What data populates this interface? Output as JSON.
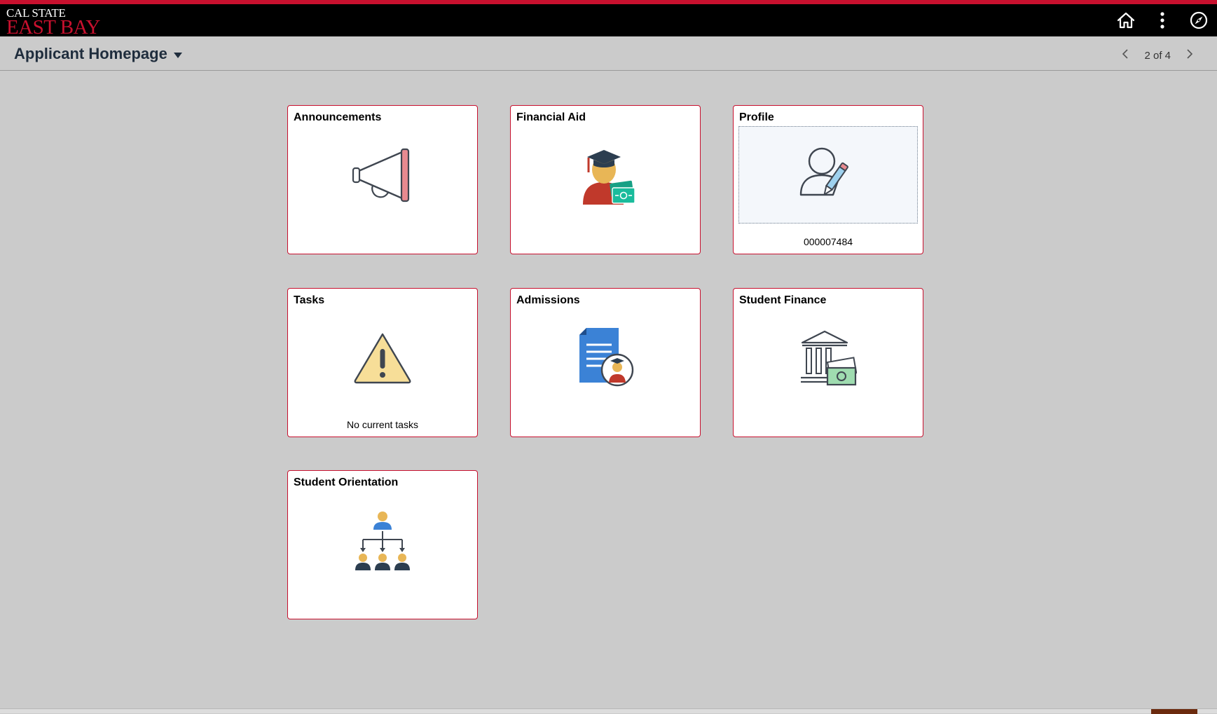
{
  "header": {
    "logo_line1": "CAL STATE",
    "logo_line2": "EAST BAY",
    "brand_red": "#c8102e",
    "icons": [
      "home-icon",
      "actions-menu-icon",
      "navbar-compass-icon"
    ]
  },
  "page": {
    "title": "Applicant Homepage",
    "pager_text": "2 of 4"
  },
  "tiles": [
    {
      "title": "Announcements",
      "icon": "megaphone-icon",
      "subtext": ""
    },
    {
      "title": "Financial Aid",
      "icon": "graduate-money-icon",
      "subtext": ""
    },
    {
      "title": "Profile",
      "icon": "person-edit-icon",
      "subtext": "000007484"
    },
    {
      "title": "Tasks",
      "icon": "warning-icon",
      "subtext": "No current tasks"
    },
    {
      "title": "Admissions",
      "icon": "document-graduate-icon",
      "subtext": ""
    },
    {
      "title": "Student Finance",
      "icon": "bank-money-icon",
      "subtext": ""
    },
    {
      "title": "Student Orientation",
      "icon": "org-chart-icon",
      "subtext": ""
    }
  ]
}
